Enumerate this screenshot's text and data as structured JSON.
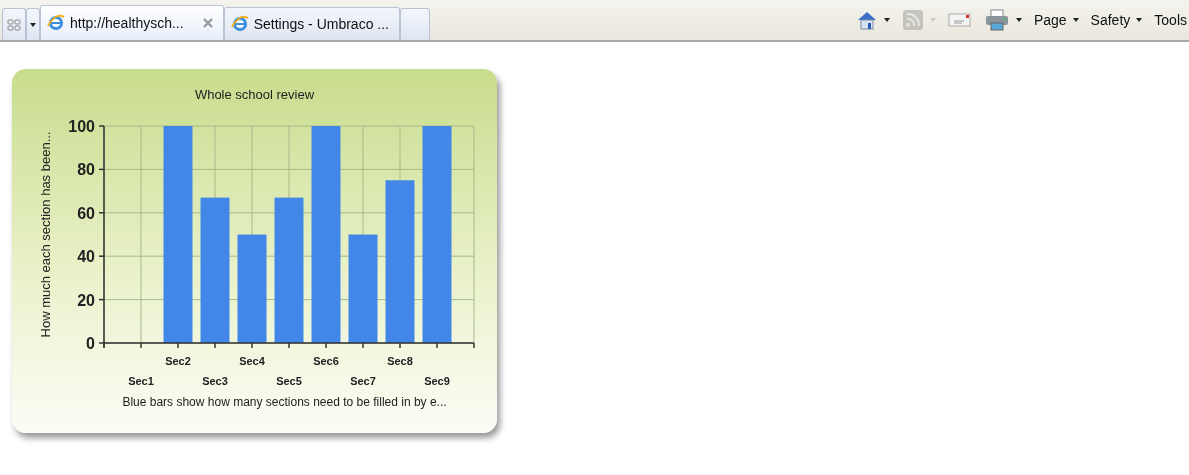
{
  "tabs": [
    {
      "title": "http://healthysch...",
      "selected": true
    },
    {
      "title": "Settings - Umbraco ...",
      "selected": false
    }
  ],
  "toolbar": [
    {
      "kind": "home",
      "menu": true,
      "disabled": false
    },
    {
      "kind": "feeds",
      "menu": true,
      "disabled": true
    },
    {
      "kind": "mail",
      "menu": false,
      "disabled": false
    },
    {
      "kind": "print",
      "menu": true,
      "disabled": false
    },
    {
      "kind": "text",
      "label": "Page",
      "menu": true,
      "disabled": false
    },
    {
      "kind": "text",
      "label": "Safety",
      "menu": true,
      "disabled": false
    },
    {
      "kind": "text",
      "label": "Tools",
      "menu": false,
      "disabled": false
    }
  ],
  "chart": {
    "caption": "Blue bars show how many sections need to be filled in by  e...",
    "chart_data": {
      "type": "bar",
      "title": "Whole school review",
      "ylabel": "How much each section has been...",
      "categories": [
        "Sec1",
        "Sec2",
        "Sec3",
        "Sec4",
        "Sec5",
        "Sec6",
        "Sec7",
        "Sec8",
        "Sec9"
      ],
      "grid": true,
      "series": [
        {
          "color": "#4287e8",
          "values": [
            0,
            100,
            67,
            50,
            67,
            100,
            50,
            75,
            100
          ]
        }
      ],
      "ylim": [
        0,
        100
      ],
      "yticks": [
        0,
        20,
        40,
        60,
        80,
        100
      ]
    }
  }
}
